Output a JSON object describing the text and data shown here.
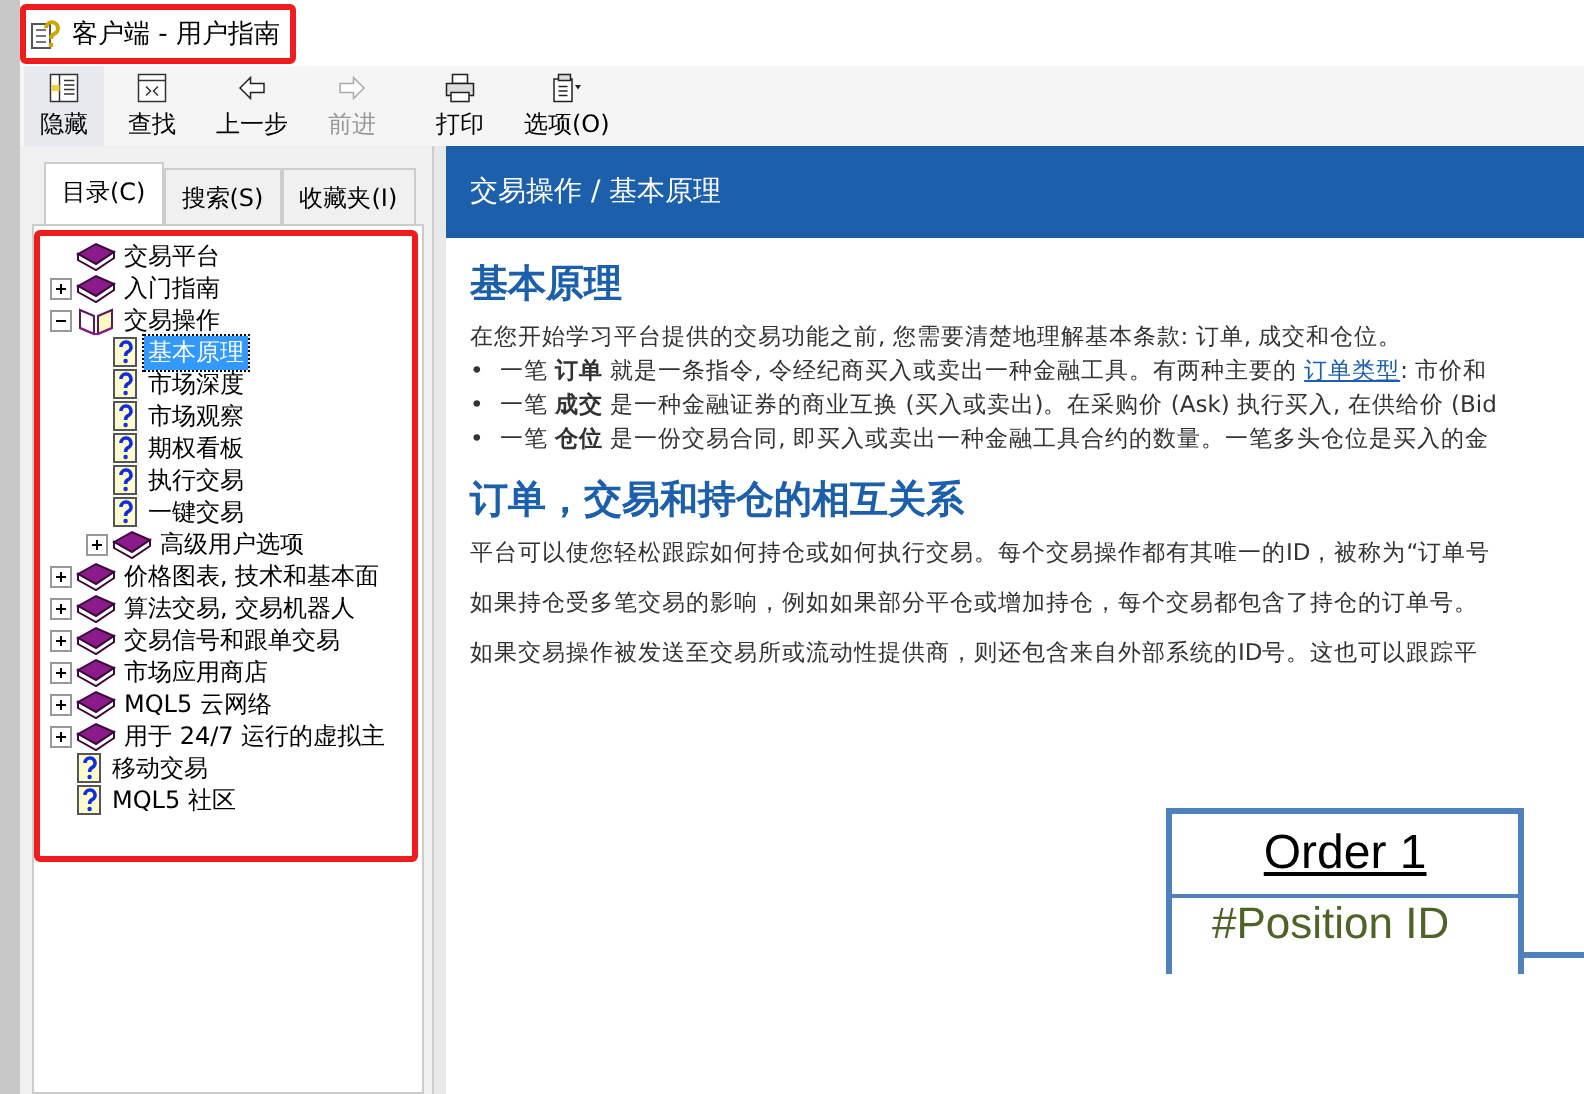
{
  "window": {
    "title": "客户端 - 用户指南"
  },
  "toolbar": [
    {
      "label": "隐藏",
      "kind": "hide",
      "pressed": true,
      "disabled": false
    },
    {
      "label": "查找",
      "kind": "find",
      "pressed": false,
      "disabled": false
    },
    {
      "label": "上一步",
      "kind": "back",
      "pressed": false,
      "disabled": false
    },
    {
      "label": "前进",
      "kind": "forward",
      "pressed": false,
      "disabled": true
    },
    {
      "label": "打印",
      "kind": "print",
      "pressed": false,
      "disabled": false
    },
    {
      "label": "选项(O)",
      "kind": "options",
      "pressed": false,
      "disabled": false
    }
  ],
  "tabs": [
    {
      "label": "目录(C)",
      "selected": true
    },
    {
      "label": "搜索(S)",
      "selected": false
    },
    {
      "label": "收藏夹(I)",
      "selected": false
    }
  ],
  "tree": [
    {
      "label": "交易平台",
      "kind": "book",
      "selected": false
    },
    {
      "label": "入门指南",
      "kind": "book",
      "expanded": false,
      "selected": false
    },
    {
      "label": "交易操作",
      "kind": "book",
      "expanded": true,
      "selected": false,
      "children": [
        {
          "label": "基本原理",
          "kind": "page",
          "selected": true
        },
        {
          "label": "市场深度",
          "kind": "page",
          "selected": false
        },
        {
          "label": "市场观察",
          "kind": "page",
          "selected": false
        },
        {
          "label": "期权看板",
          "kind": "page",
          "selected": false
        },
        {
          "label": "执行交易",
          "kind": "page",
          "selected": false
        },
        {
          "label": "一键交易",
          "kind": "page",
          "selected": false
        },
        {
          "label": "高级用户选项",
          "kind": "book",
          "expanded": false,
          "selected": false
        }
      ]
    },
    {
      "label": "价格图表, 技术和基本面",
      "kind": "book",
      "expanded": false,
      "selected": false
    },
    {
      "label": "算法交易, 交易机器人",
      "kind": "book",
      "expanded": false,
      "selected": false
    },
    {
      "label": "交易信号和跟单交易",
      "kind": "book",
      "expanded": false,
      "selected": false
    },
    {
      "label": "市场应用商店",
      "kind": "book",
      "expanded": false,
      "selected": false
    },
    {
      "label": "MQL5 云网络",
      "kind": "book",
      "expanded": false,
      "selected": false
    },
    {
      "label": "用于 24/7 运行的虚拟主",
      "kind": "book",
      "expanded": false,
      "selected": false
    },
    {
      "label": "移动交易",
      "kind": "page",
      "selected": false
    },
    {
      "label": "MQL5 社区",
      "kind": "page",
      "selected": false
    }
  ],
  "content": {
    "breadcrumb": "交易操作 / 基本原理",
    "heading": "基本原理",
    "intro": "在您开始学习平台提供的交易功能之前, 您需要清楚地理解基本条款: 订单, 成交和仓位。",
    "bullets": [
      {
        "marker": "•",
        "text": "一笔 **订单** 就是一条指令, 令经纪商买入或卖出一种金融工具。有两种主要的 ",
        "link": "订单类型",
        "after": ": 市价和"
      },
      {
        "marker": "•",
        "text": "一笔 **成交** 是一种金融证券的商业互换 (买入或卖出)。在采购价 (Ask) 执行买入, 在供给价 (Bid"
      },
      {
        "marker": "•",
        "text": "一笔 **仓位** 是一份交易合同, 即买入或卖出一种金融工具合约的数量。一笔多头仓位是买入的金"
      }
    ],
    "heading2": "订单，交易和持仓的相互关系",
    "paragraphs": [
      "平台可以使您轻松跟踪如何持仓或如何执行交易。每个交易操作都有其唯一的ID，被称为“订单号",
      "如果持仓受多笔交易的影响，例如如果部分平仓或增加持仓，每个交易都包含了持仓的订单号。",
      "如果交易操作被发送至交易所或流动性提供商，则还包含来自外部系统的ID号。这也可以跟踪平"
    ],
    "diagram": {
      "title": "Order 1",
      "field": "#Position ID"
    }
  }
}
